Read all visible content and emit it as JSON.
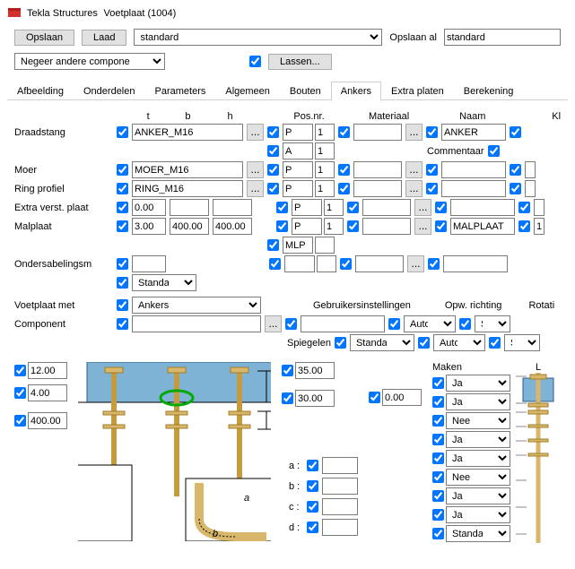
{
  "window": {
    "app": "Tekla Structures",
    "title": "Voetplaat (1004)"
  },
  "toolbar": {
    "save": "Opslaan",
    "load": "Laad",
    "preset": "standard",
    "save_as_label": "Opslaan al",
    "save_as_value": "standard",
    "ignore_combo": "Negeer andere compone",
    "welds": "Lassen..."
  },
  "tabs": [
    "Afbeelding",
    "Onderdelen",
    "Parameters",
    "Algemeen",
    "Bouten",
    "Ankers",
    "Extra platen",
    "Berekening"
  ],
  "active_tab": "Ankers",
  "headers": {
    "t": "t",
    "b": "b",
    "h": "h",
    "posnr": "Pos.nr.",
    "materiaal": "Materiaal",
    "naam": "Naam",
    "kl": "Kl",
    "commentaar": "Commentaar"
  },
  "rows": [
    {
      "label": "Draadstang",
      "wide": "ANKER_M16",
      "p": "P",
      "n": "1",
      "mat": "",
      "naam": "ANKER"
    },
    {
      "label": "",
      "p": "A",
      "n": "1"
    },
    {
      "label": "Moer",
      "wide": "MOER_M16",
      "p": "P",
      "n": "1",
      "mat": "",
      "naam": ""
    },
    {
      "label": "Ring profiel",
      "wide": "RING_M16",
      "p": "P",
      "n": "1",
      "mat": "",
      "naam": ""
    },
    {
      "label": "Extra verst. plaat",
      "t": "0.00",
      "b": "",
      "h": "",
      "p": "P",
      "n": "1",
      "mat": "",
      "naam": ""
    },
    {
      "label": "Malplaat",
      "t": "3.00",
      "b": "400.00",
      "h": "400.00",
      "p": "P",
      "n": "1",
      "mat": "",
      "naam": "MALPLAAT"
    },
    {
      "label": "",
      "p": "MLP",
      "n": ""
    },
    {
      "label": "Ondersabelingsm",
      "t": "",
      "sel": "Standaar",
      "p": "",
      "n": "",
      "mat": "",
      "naam": ""
    }
  ],
  "voetplaat_met": {
    "label": "Voetplaat met",
    "value": "Ankers"
  },
  "component": {
    "label": "Component",
    "value": ""
  },
  "gebruiker": {
    "label": "Gebruikersinstellingen"
  },
  "spiegelen": {
    "label": "Spiegelen",
    "value": "Standaar"
  },
  "opw": {
    "label": "Opw. richting",
    "v1": "Auto",
    "v2": "Auto"
  },
  "rotatie": {
    "label": "Rotati",
    "v1": "Stan",
    "v2": "Stan"
  },
  "dims": {
    "d1": "12.00",
    "d2": "4.00",
    "d3": "400.00",
    "d4": "35.00",
    "d5": "30.00",
    "d6": "0.00"
  },
  "abcd": {
    "a": "a :",
    "b": "b :",
    "c": "c :",
    "d": "d :"
  },
  "maken": {
    "label": "Maken",
    "items": [
      "Ja",
      "Ja",
      "Nee",
      "Ja",
      "Ja",
      "Nee",
      "Ja",
      "Ja",
      "Standaar"
    ]
  },
  "l_label": "L",
  "diagram_labels": {
    "a": "a",
    "b": "b"
  }
}
